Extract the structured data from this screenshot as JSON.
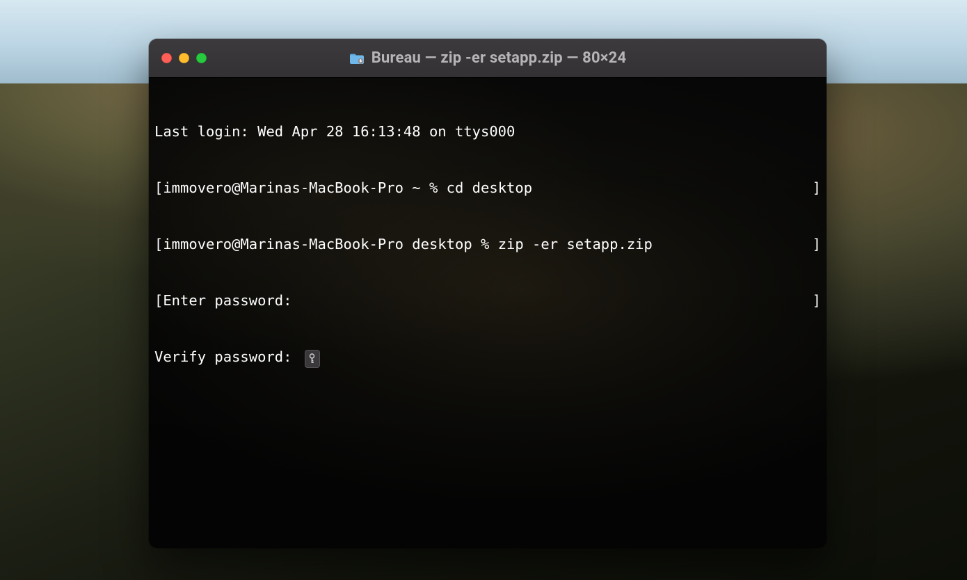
{
  "window": {
    "title": "Bureau — zip -er setapp.zip — 80×24",
    "folder_icon": "folder-download-icon"
  },
  "terminal": {
    "last_login": "Last login: Wed Apr 28 16:13:48 on ttys000",
    "line2": {
      "left_bracket": "[",
      "prompt": "immovero@Marinas-MacBook-Pro ~ % ",
      "command": "cd desktop",
      "right_bracket": "]"
    },
    "line3": {
      "left_bracket": "[",
      "prompt": "immovero@Marinas-MacBook-Pro desktop % ",
      "command": "zip -er setapp.zip",
      "right_bracket": "]"
    },
    "line4": {
      "left_bracket": "[",
      "text": "Enter password: ",
      "right_bracket": "]"
    },
    "line5": {
      "text": "Verify password: ",
      "key_icon": "key-icon"
    }
  }
}
